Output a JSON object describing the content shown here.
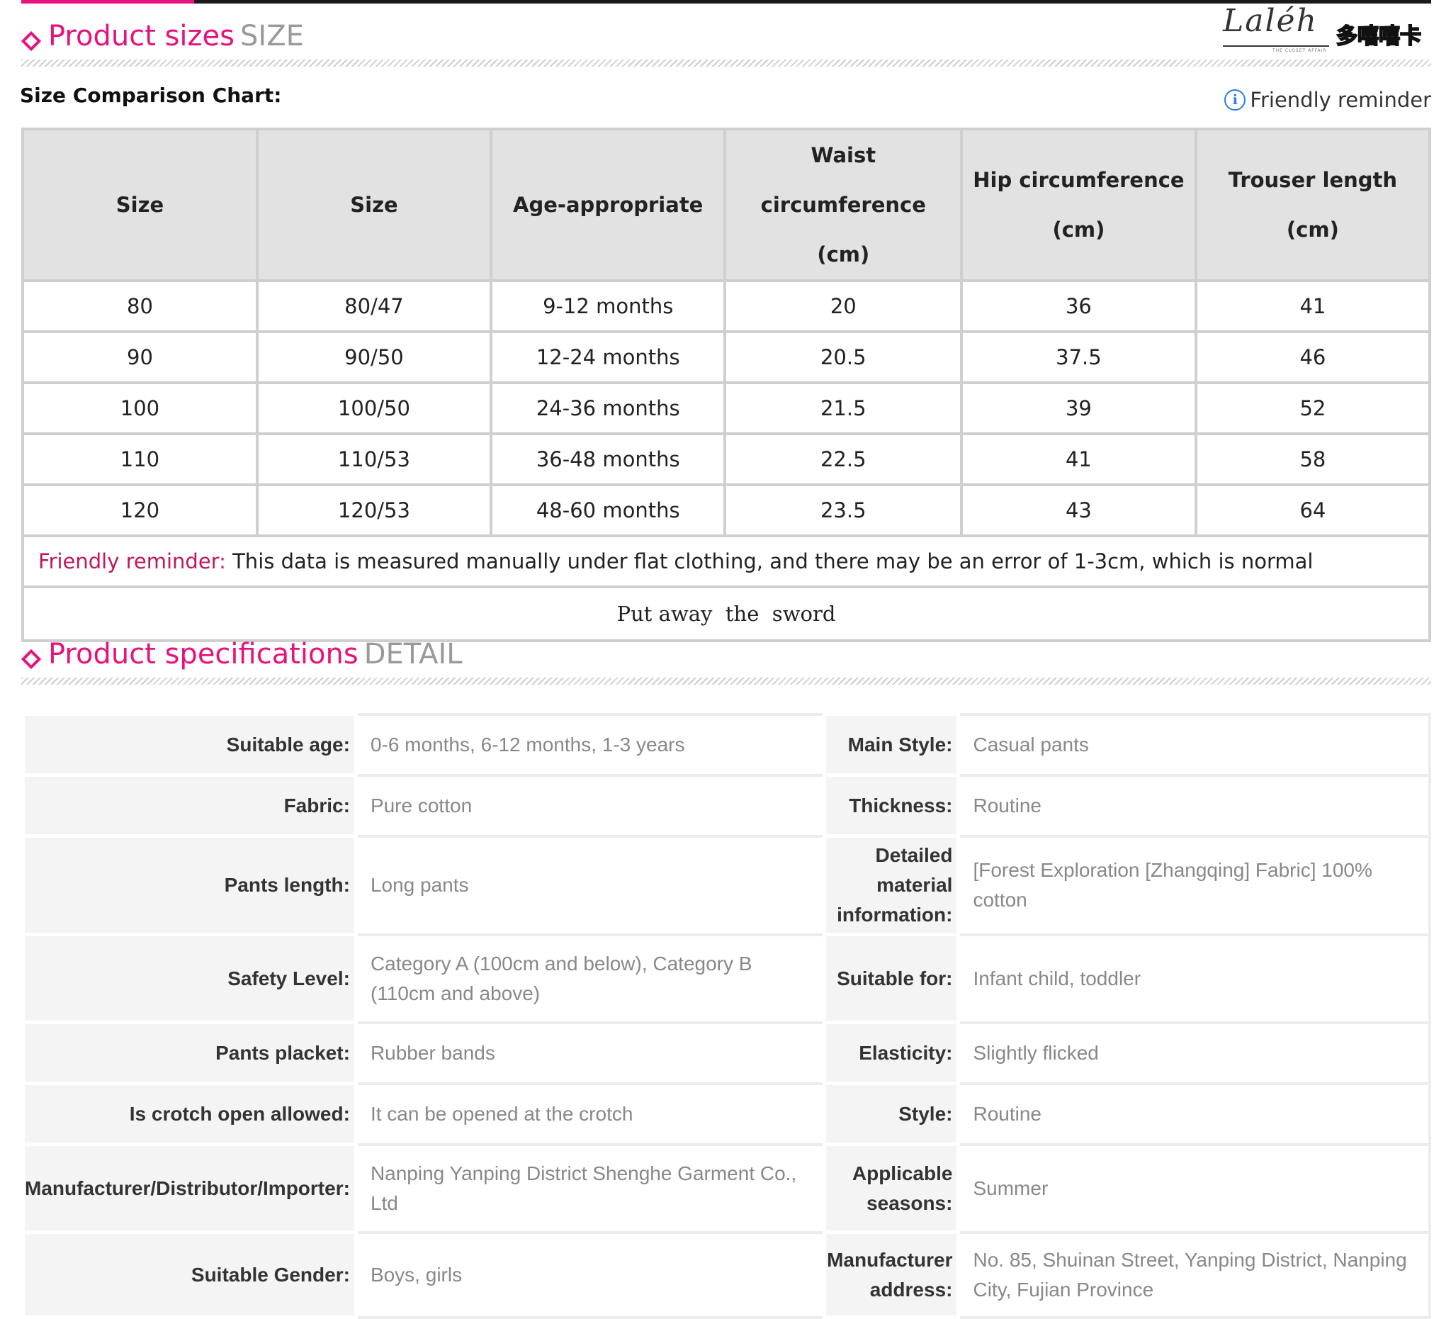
{
  "section_size": {
    "title": "Product sizes",
    "title_en": "SIZE"
  },
  "logo": {
    "script": "Laléh",
    "sub": "THE CLOSET AFFAIR",
    "badge": "多嘻嘻卡"
  },
  "chart_label": "Size Comparison Chart:",
  "reminder_link": "Friendly reminder",
  "size_table": {
    "headers": [
      "Size",
      "Size",
      "Age-appropriate",
      "Waist circumference (cm)",
      "Hip circumference (cm)",
      "Trouser length (cm)"
    ],
    "rows": [
      [
        "80",
        "80/47",
        "9-12 months",
        "20",
        "36",
        "41"
      ],
      [
        "90",
        "90/50",
        "12-24 months",
        "20.5",
        "37.5",
        "46"
      ],
      [
        "100",
        "100/50",
        "24-36 months",
        "21.5",
        "39",
        "52"
      ],
      [
        "110",
        "110/53",
        "36-48 months",
        "22.5",
        "41",
        "58"
      ],
      [
        "120",
        "120/53",
        "48-60 months",
        "23.5",
        "43",
        "64"
      ]
    ],
    "note_label": "Friendly reminder:",
    "note_text": " This data is measured manually under flat clothing, and there may be an error of 1-3cm, which is normal",
    "footer": "Put away  the  sword"
  },
  "section_spec": {
    "title": "Product specifications",
    "title_en": "DETAIL"
  },
  "specs": [
    {
      "l1": "Suitable age:",
      "v1": "0-6 months, 6-12 months, 1-3 years",
      "l2": "Main Style:",
      "v2": "Casual pants"
    },
    {
      "l1": "Fabric:",
      "v1": "Pure cotton",
      "l2": "Thickness:",
      "v2": "Routine"
    },
    {
      "l1": "Pants length:",
      "v1": "Long pants",
      "l2": "Detailed material information:",
      "v2": "[Forest Exploration [Zhangqing] Fabric] 100% cotton"
    },
    {
      "l1": "Safety Level:",
      "v1": "Category A (100cm and below), Category B (110cm and above)",
      "l2": "Suitable for:",
      "v2": "Infant child, toddler"
    },
    {
      "l1": "Pants placket:",
      "v1": "Rubber bands",
      "l2": "Elasticity:",
      "v2": "Slightly flicked"
    },
    {
      "l1": "Is crotch open allowed:",
      "v1": "It can be opened at the crotch",
      "l2": "Style:",
      "v2": "Routine"
    },
    {
      "l1": "Manufacturer/Distributor/Importer:",
      "v1": "Nanping Yanping District Shenghe Garment Co., Ltd",
      "l2": "Applicable seasons:",
      "v2": "Summer"
    },
    {
      "l1": "Suitable Gender:",
      "v1": "Boys, girls",
      "l2": "Manufacturer address:",
      "v2": "No. 85, Shuinan Street, Yanping District, Nanping City, Fujian Province"
    }
  ],
  "colors": {
    "accent": "#e8127c",
    "header_bg": "#e2e2e2",
    "border": "#cfcfcf",
    "value_text": "#888888"
  }
}
